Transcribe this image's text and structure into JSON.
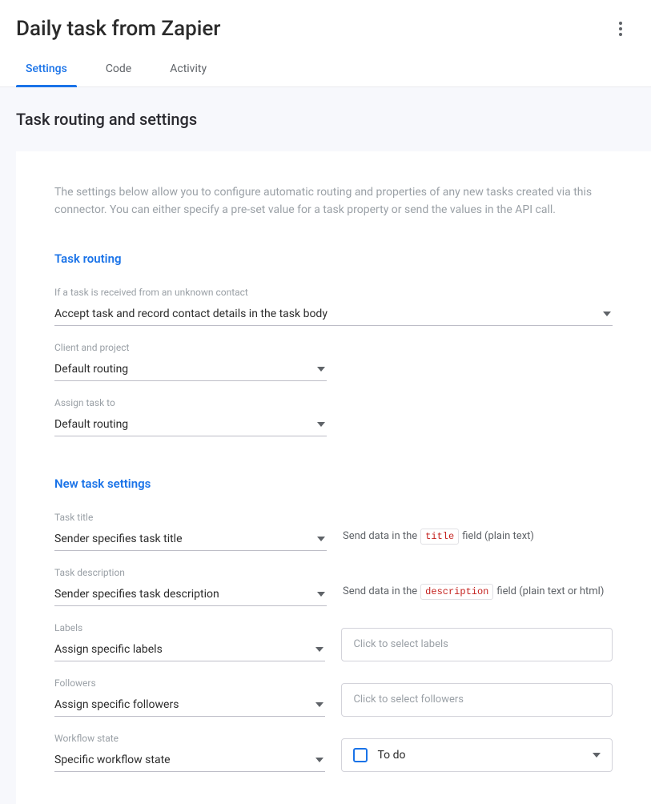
{
  "header": {
    "title": "Daily task from Zapier"
  },
  "tabs": [
    {
      "label": "Settings",
      "active": true
    },
    {
      "label": "Code",
      "active": false
    },
    {
      "label": "Activity",
      "active": false
    }
  ],
  "section_title": "Task routing and settings",
  "intro": "The settings below allow you to configure automatic routing and properties of any new tasks created via this connector. You can either specify a pre-set value for a task property or send the values in the API call.",
  "routing": {
    "heading": "Task routing",
    "unknown_contact": {
      "label": "If a task is received from an unknown contact",
      "value": "Accept task and record contact details in the task body"
    },
    "client_project": {
      "label": "Client and project",
      "value": "Default routing"
    },
    "assign_to": {
      "label": "Assign task to",
      "value": "Default routing"
    }
  },
  "new_task": {
    "heading": "New task settings",
    "task_title": {
      "label": "Task title",
      "value": "Sender specifies task title",
      "hint_prefix": "Send data in the",
      "hint_code": "title",
      "hint_suffix": "field (plain text)"
    },
    "task_description": {
      "label": "Task description",
      "value": "Sender specifies task description",
      "hint_prefix": "Send data in the",
      "hint_code": "description",
      "hint_suffix": "field (plain text or html)"
    },
    "labels": {
      "label": "Labels",
      "value": "Assign specific labels",
      "placeholder": "Click to select labels"
    },
    "followers": {
      "label": "Followers",
      "value": "Assign specific followers",
      "placeholder": "Click to select followers"
    },
    "workflow": {
      "label": "Workflow state",
      "value": "Specific workflow state",
      "dropdown_value": "To do"
    }
  }
}
